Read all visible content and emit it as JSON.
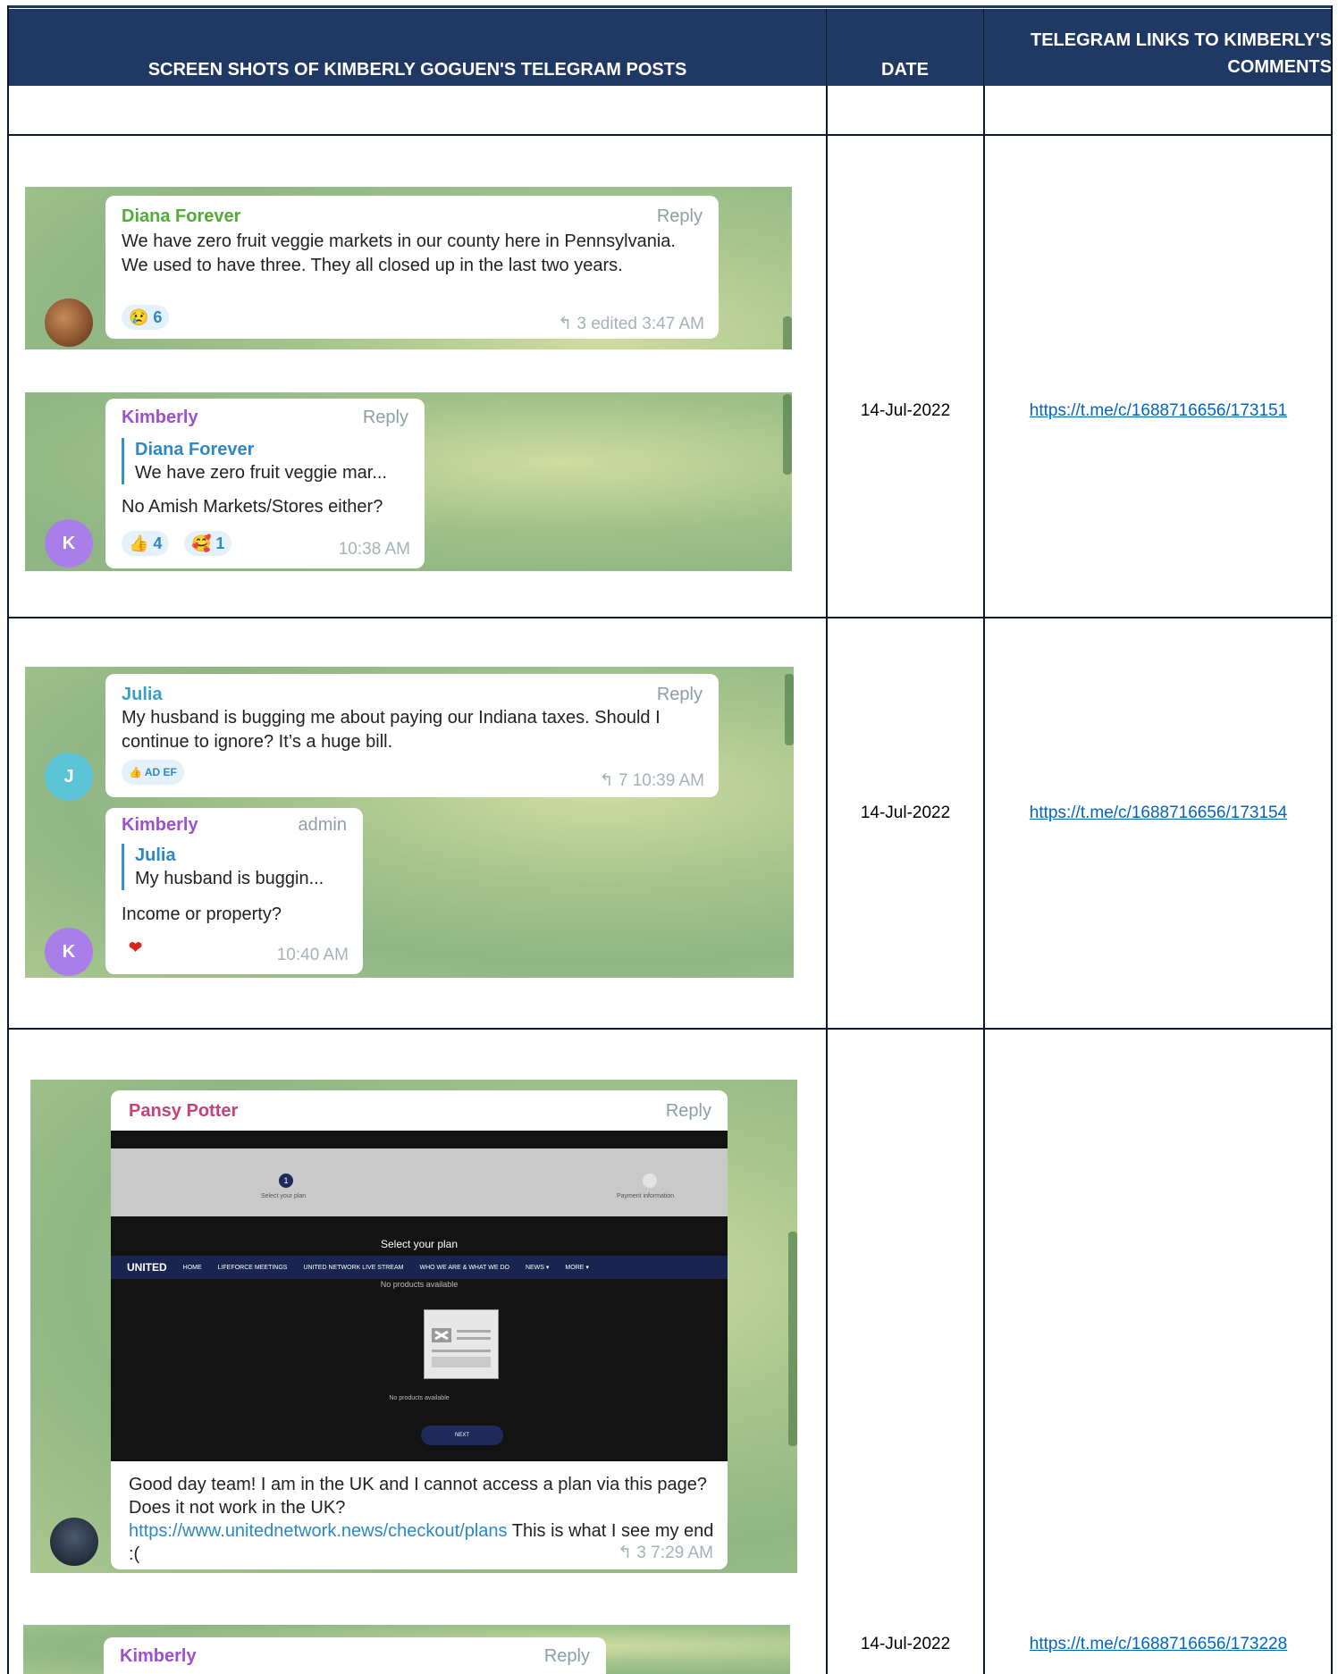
{
  "header": {
    "col1": "SCREEN SHOTS OF KIMBERLY GOGUEN'S TELEGRAM POSTS",
    "col2": "DATE",
    "col3_line1": "TELEGRAM LINKS TO KIMBERLY'S",
    "col3_line2": "COMMENTS"
  },
  "rows": [
    {
      "date": "14-Jul-2022",
      "link": "https://t.me/c/1688716656/173151",
      "post": {
        "name": "Diana Forever",
        "reply": "Reply",
        "text": "We have zero fruit veggie markets in our county here in Pennsylvania. We used to have three. They all closed up in the last two years.",
        "reaction": "😢 6",
        "meta": "↰ 3  edited 3:47 AM"
      },
      "comment": {
        "name": "Kimberly",
        "reply": "Reply",
        "quote_name": "Diana Forever",
        "quote_text": "We have zero fruit veggie mar...",
        "text": "No Amish Markets/Stores either?",
        "reaction1": "👍 4",
        "reaction2": "🥰 1",
        "time": "10:38 AM",
        "avatar": "K"
      }
    },
    {
      "date": "14-Jul-2022",
      "link": "https://t.me/c/1688716656/173154",
      "post": {
        "name": "Julia",
        "reply": "Reply",
        "text": "My husband is bugging me about paying our Indiana taxes. Should I continue to ignore?  It’s a huge bill.",
        "reaction": "👍 AD EF",
        "meta": "↰ 7  10:39 AM",
        "avatar": "J"
      },
      "comment": {
        "name": "Kimberly",
        "badge": "admin",
        "quote_name": "Julia",
        "quote_text": "My husband is buggin...",
        "text": "Income or property?",
        "reaction": "❤",
        "time": "10:40 AM",
        "avatar": "K"
      }
    },
    {
      "date": "14-Jul-2022",
      "link": "https://t.me/c/1688716656/173228",
      "post": {
        "name": "Pansy Potter",
        "reply": "Reply",
        "site_step1": "Select your plan",
        "site_step2": "Payment information",
        "site_title": "Select your plan",
        "site_logo": "UNITED",
        "site_nav": [
          "HOME",
          "LIFEFORCE MEETINGS",
          "UNITED NETWORK LIVE STREAM",
          "WHO WE ARE & WHAT WE DO",
          "NEWS ▾",
          "MORE ▾"
        ],
        "site_none": "No products available",
        "site_none2": "No products available",
        "site_next": "NEXT",
        "text_before": "Good day team!  I am in the UK and I cannot access a plan via this page?  Does it not work in the UK?",
        "text_link": "https://www.unitednetwork.news/checkout/plans",
        "text_after": " This is what I see my end  :(",
        "meta": "↰ 3  7:29 AM"
      },
      "comment": {
        "name": "Kimberly",
        "reply": "Reply"
      }
    }
  ]
}
